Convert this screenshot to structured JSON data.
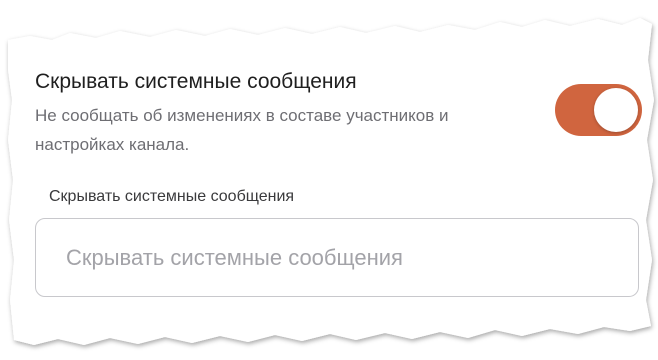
{
  "setting": {
    "title": "Скрывать системные сообщения",
    "description": "Не сообщать об изменениях в составе участников и настройках канала.",
    "toggle_on": true
  },
  "field": {
    "label": "Скрывать системные сообщения",
    "placeholder": "Скрывать системные сообщения",
    "value": ""
  },
  "colors": {
    "accent": "#d0653f",
    "input_border": "#c8c8cc",
    "placeholder": "#a3a3a8"
  }
}
